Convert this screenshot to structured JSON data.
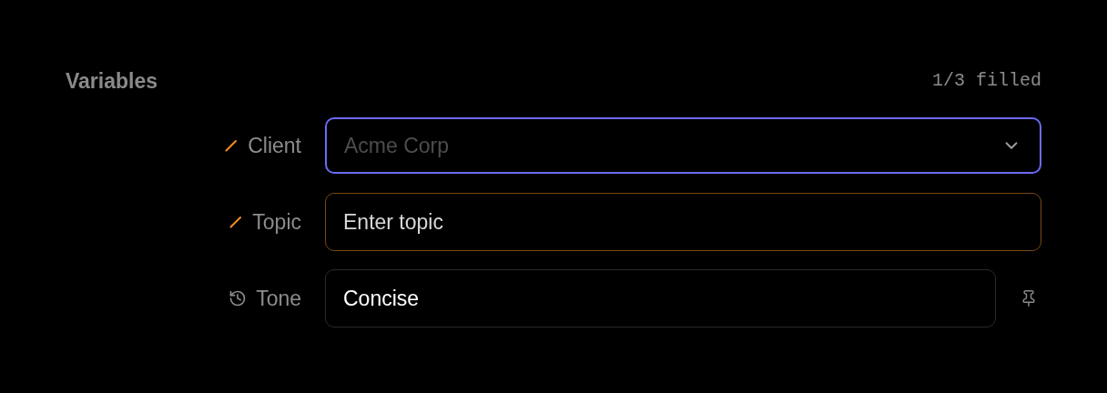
{
  "section": {
    "title": "Variables",
    "progress": "1/3 filled"
  },
  "variables": [
    {
      "kind": "select",
      "label": "Client",
      "placeholder": "Acme Corp",
      "focused": true,
      "edited": true,
      "pin_button": false
    },
    {
      "kind": "text",
      "label": "Topic",
      "value": "Enter topic",
      "focused": false,
      "edited": true,
      "pin_button": false
    },
    {
      "kind": "text",
      "label": "Tone",
      "value": "Concise",
      "focused": false,
      "edited": false,
      "pin_button": true
    }
  ]
}
